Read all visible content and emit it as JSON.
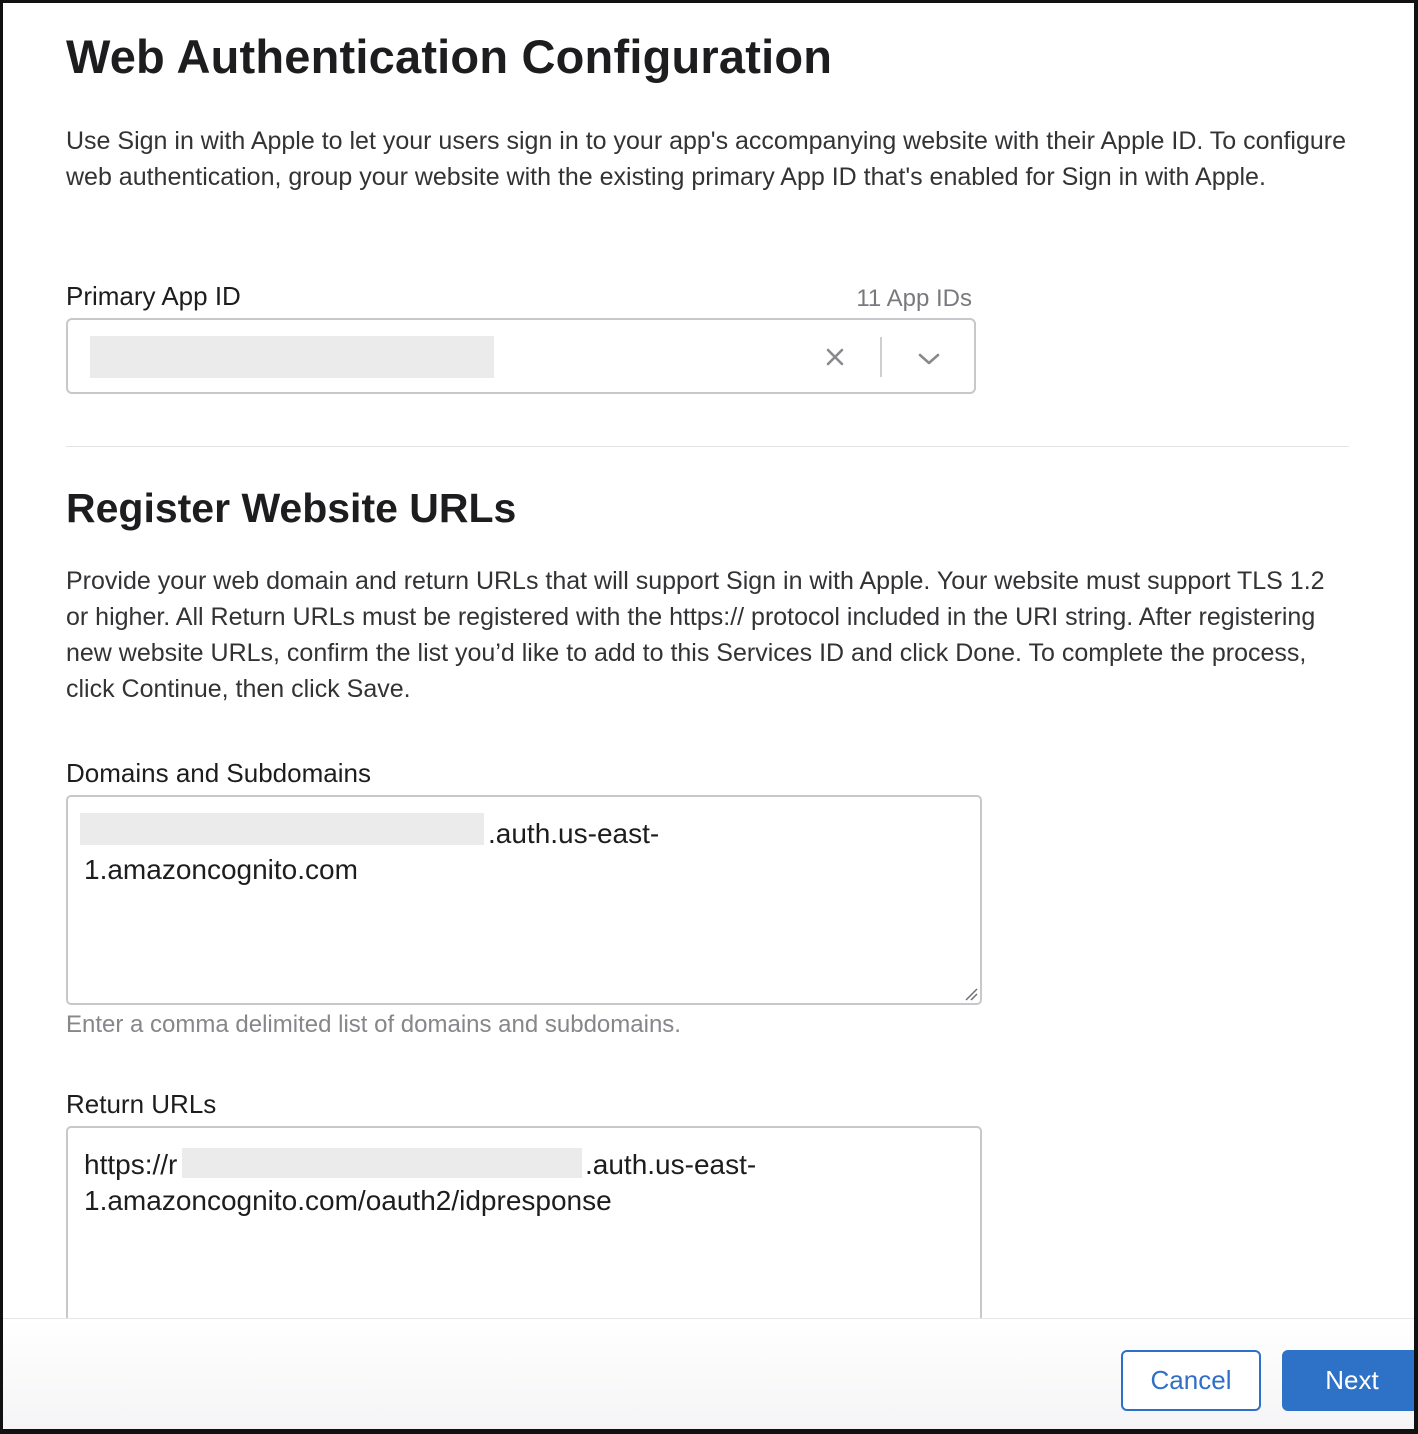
{
  "page": {
    "title": "Web Authentication Configuration",
    "intro": "Use Sign in with Apple to let your users sign in to your app's accompanying website with their Apple ID. To configure web authentication, group your website with the existing primary App ID that's enabled for Sign in with Apple."
  },
  "primary_app_id": {
    "label": "Primary App ID",
    "count": "11 App IDs"
  },
  "register": {
    "title": "Register Website URLs",
    "description": "Provide your web domain and return URLs that will support Sign in with Apple. Your website must support TLS 1.2 or higher. All Return URLs must be registered with the https:// protocol included in the URI string. After registering new website URLs, confirm the list you’d like to add to this Services ID and click Done. To complete the process, click Continue, then click Save."
  },
  "domains": {
    "label": "Domains and Subdomains",
    "line1_suffix": ".auth.us-east-",
    "line2": "1.amazoncognito.com",
    "hint": "Enter a comma delimited list of domains and subdomains."
  },
  "return_urls": {
    "label": "Return URLs",
    "line1_prefix": "https://r",
    "line1_suffix": ".auth.us-east-",
    "line2": "1.amazoncognito.com/oauth2/idpresponse"
  },
  "footer": {
    "cancel_label": "Cancel",
    "next_label": "Next"
  },
  "colors": {
    "accent": "#2d72c6",
    "border": "#c8c8cc",
    "redaction": "#ebebeb"
  }
}
